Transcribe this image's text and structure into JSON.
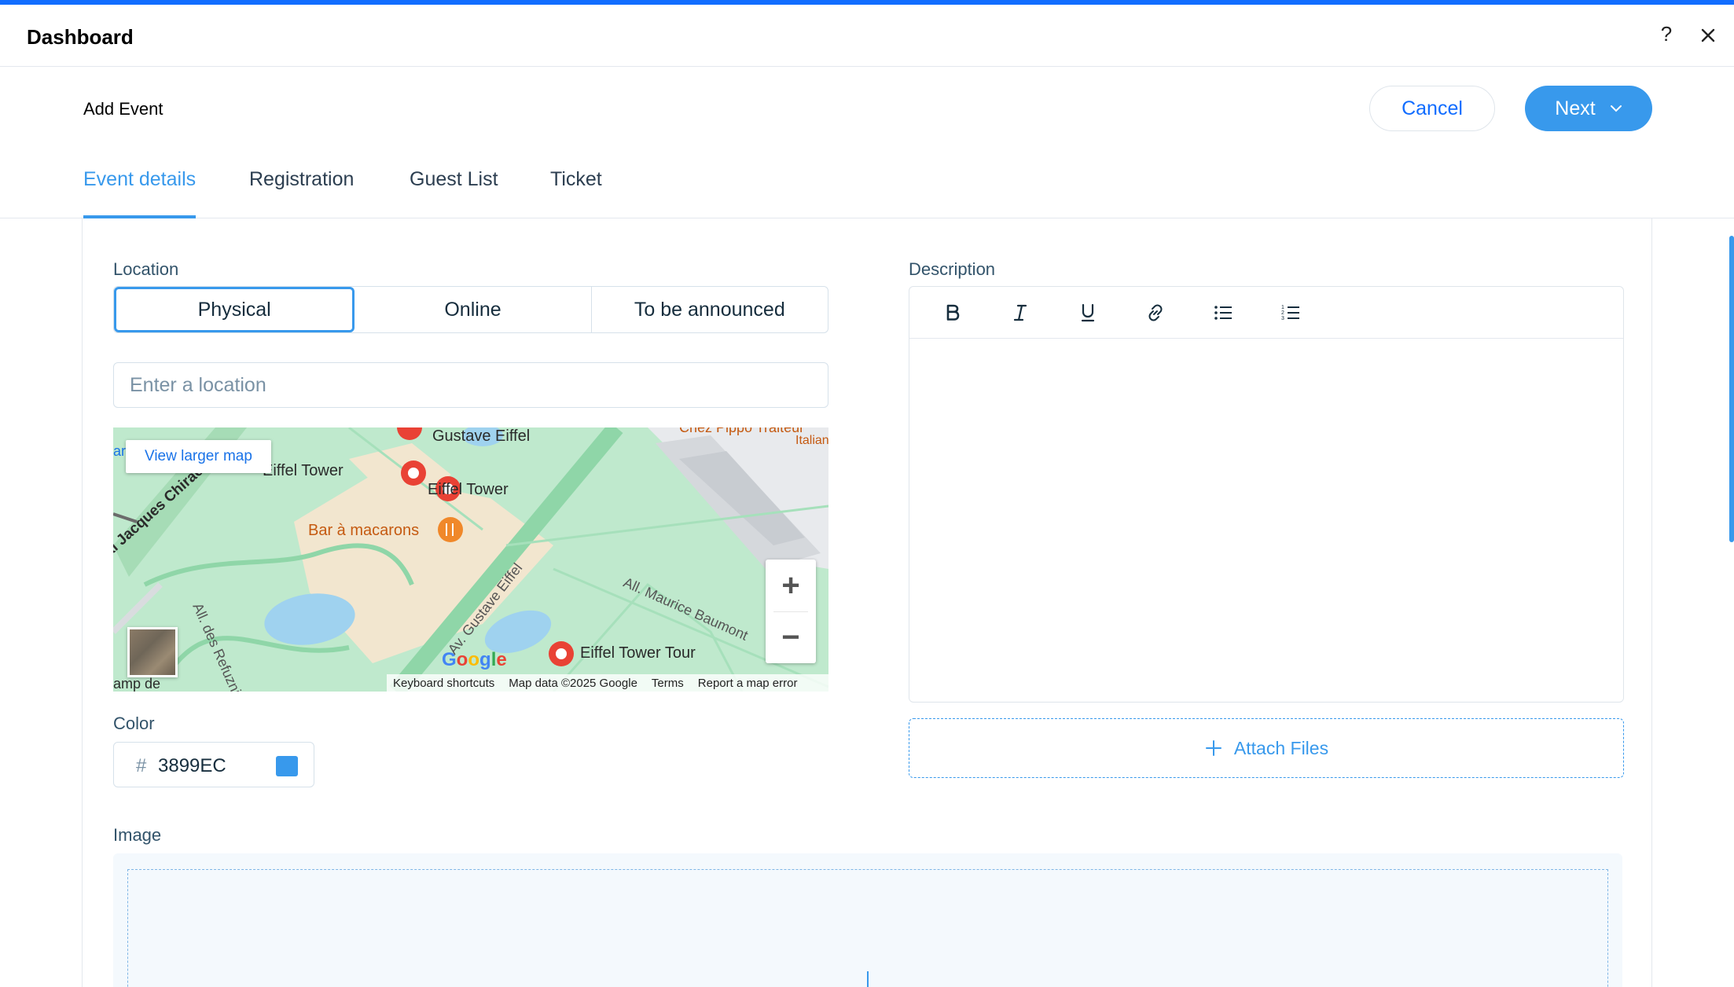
{
  "window": {
    "title": "Dashboard",
    "help": "?"
  },
  "header": {
    "page_title": "Add Event",
    "cancel_label": "Cancel",
    "next_label": "Next"
  },
  "tabs": [
    {
      "label": "Event details",
      "active": true
    },
    {
      "label": "Registration",
      "active": false
    },
    {
      "label": "Guest List",
      "active": false
    },
    {
      "label": "Ticket",
      "active": false
    }
  ],
  "location": {
    "label": "Location",
    "options": [
      "Physical",
      "Online",
      "To be announced"
    ],
    "selected": "Physical",
    "placeholder": "Enter a location"
  },
  "map": {
    "view_larger": "View larger map",
    "labels": {
      "gustave_eiffel": "Gustave Eiffel",
      "eiffel_tower_left": "Eiffel Tower",
      "eiffel_tower": "Eiffel Tower",
      "bar_macarons": "Bar à macarons",
      "jacques_chirac": "ai Jacques Chirac",
      "maurice_baumont": "All. Maurice Baumont",
      "gustave_eiffel_av": "Av. Gustave Eiffel",
      "refuzniks": "All. des Refuzniks",
      "eiffel_tower_tour": "Eiffel Tower Tour",
      "chez_pippo": "Chez Pippo Traiteur",
      "italian": "Italian",
      "amp_de": "amp de",
      "ar_fragment": "ar"
    },
    "google_logo": "Google",
    "attribution": [
      "Keyboard shortcuts",
      "Map data ©2025 Google",
      "Terms",
      "Report a map error"
    ]
  },
  "color": {
    "label": "Color",
    "hash": "#",
    "value": "3899EC",
    "swatch_color": "#3899ec"
  },
  "description": {
    "label": "Description",
    "toolbar": [
      "bold",
      "italic",
      "underline",
      "link",
      "bulleted-list",
      "numbered-list"
    ]
  },
  "attach": {
    "label": "Attach Files"
  },
  "image": {
    "label": "Image"
  },
  "colors": {
    "accent": "#3899ec",
    "brand_blue": "#116dff"
  }
}
